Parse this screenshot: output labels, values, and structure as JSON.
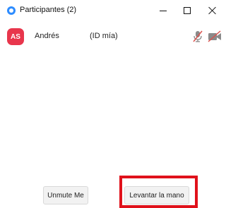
{
  "window": {
    "title": "Participantes (2)",
    "controls": [
      "minimize-icon",
      "maximize-icon",
      "close-icon"
    ]
  },
  "participants": [
    {
      "initials": "AS",
      "name": "Andrés",
      "tag": "(ID mía)",
      "avatar_color": "#e8364c",
      "mic_icon": "mic-muted-icon",
      "video_icon": "video-off-icon",
      "status_color": "#d9534f"
    }
  ],
  "footer": {
    "unmute_label": "Unmute Me",
    "raise_hand_label": "Levantar la mano",
    "highlight_color": "#e0111b"
  },
  "colors": {
    "accent": "#2d8cff"
  }
}
